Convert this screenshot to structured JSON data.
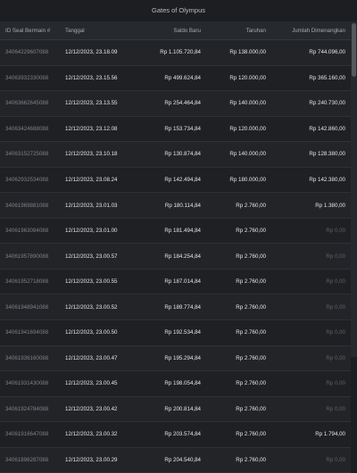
{
  "title": "Gates of Olympus",
  "columns": {
    "id": "ID Seal Bermain #",
    "date": "Tanggal",
    "balance": "Saldo Baru",
    "bet": "Taruhan",
    "win": "Jumlah Dimenangkan"
  },
  "rows": [
    {
      "id": "34064229607088",
      "date": "12/12/2023, 23.18.09",
      "balance": "Rp 1.105.720,84",
      "bet": "Rp 138.000,00",
      "win": "Rp 744.096,00",
      "win_dim": false
    },
    {
      "id": "34063932330088",
      "date": "12/12/2023, 23.15.56",
      "balance": "Rp 499.624,84",
      "bet": "Rp 120.000,00",
      "win": "Rp 365.160,00",
      "win_dim": false
    },
    {
      "id": "34063662645088",
      "date": "12/12/2023, 23.13.55",
      "balance": "Rp 254.464,84",
      "bet": "Rp 140.000,00",
      "win": "Rp 240.730,00",
      "win_dim": false
    },
    {
      "id": "34063424688088",
      "date": "12/12/2023, 23.12.08",
      "balance": "Rp 153.734,84",
      "bet": "Rp 120.000,00",
      "win": "Rp 142.860,00",
      "win_dim": false
    },
    {
      "id": "34063152725088",
      "date": "12/12/2023, 23.10.18",
      "balance": "Rp 130.874,84",
      "bet": "Rp 140.000,00",
      "win": "Rp 128.380,00",
      "win_dim": false
    },
    {
      "id": "34062932534088",
      "date": "12/12/2023, 23.08.24",
      "balance": "Rp 142.494,84",
      "bet": "Rp 180.000,00",
      "win": "Rp 142.380,00",
      "win_dim": false
    },
    {
      "id": "34061969881088",
      "date": "12/12/2023, 23.01.03",
      "balance": "Rp 180.114,84",
      "bet": "Rp 2.760,00",
      "win": "Rp 1.380,00",
      "win_dim": false
    },
    {
      "id": "34061963084088",
      "date": "12/12/2023, 23.01.00",
      "balance": "Rp 181.494,84",
      "bet": "Rp 2.760,00",
      "win": "Rp 0,00",
      "win_dim": true
    },
    {
      "id": "34061957890088",
      "date": "12/12/2023, 23.00.57",
      "balance": "Rp 184.254,84",
      "bet": "Rp 2.760,00",
      "win": "Rp 0,00",
      "win_dim": true
    },
    {
      "id": "34061952718088",
      "date": "12/12/2023, 23.00.55",
      "balance": "Rp 187.014,84",
      "bet": "Rp 2.760,00",
      "win": "Rp 0,00",
      "win_dim": true
    },
    {
      "id": "34061948941088",
      "date": "12/12/2023, 23.00.52",
      "balance": "Rp 189.774,84",
      "bet": "Rp 2.760,00",
      "win": "Rp 0,00",
      "win_dim": true
    },
    {
      "id": "34061941694088",
      "date": "12/12/2023, 23.00.50",
      "balance": "Rp 192.534,84",
      "bet": "Rp 2.760,00",
      "win": "Rp 0,00",
      "win_dim": true
    },
    {
      "id": "34061936160088",
      "date": "12/12/2023, 23.00.47",
      "balance": "Rp 195.294,84",
      "bet": "Rp 2.760,00",
      "win": "Rp 0,00",
      "win_dim": true
    },
    {
      "id": "34061931430088",
      "date": "12/12/2023, 23.00.45",
      "balance": "Rp 198.054,84",
      "bet": "Rp 2.760,00",
      "win": "Rp 0,00",
      "win_dim": true
    },
    {
      "id": "34061924784088",
      "date": "12/12/2023, 23.00.42",
      "balance": "Rp 200.814,84",
      "bet": "Rp 2.760,00",
      "win": "Rp 0,00",
      "win_dim": true
    },
    {
      "id": "34061916647088",
      "date": "12/12/2023, 23.00.32",
      "balance": "Rp 203.574,84",
      "bet": "Rp 2.760,00",
      "win": "Rp 1.794,00",
      "win_dim": false
    },
    {
      "id": "34061896287088",
      "date": "12/12/2023, 23.00.29",
      "balance": "Rp 204.540,84",
      "bet": "Rp 2.760,00",
      "win": "Rp 0,00",
      "win_dim": true
    }
  ]
}
